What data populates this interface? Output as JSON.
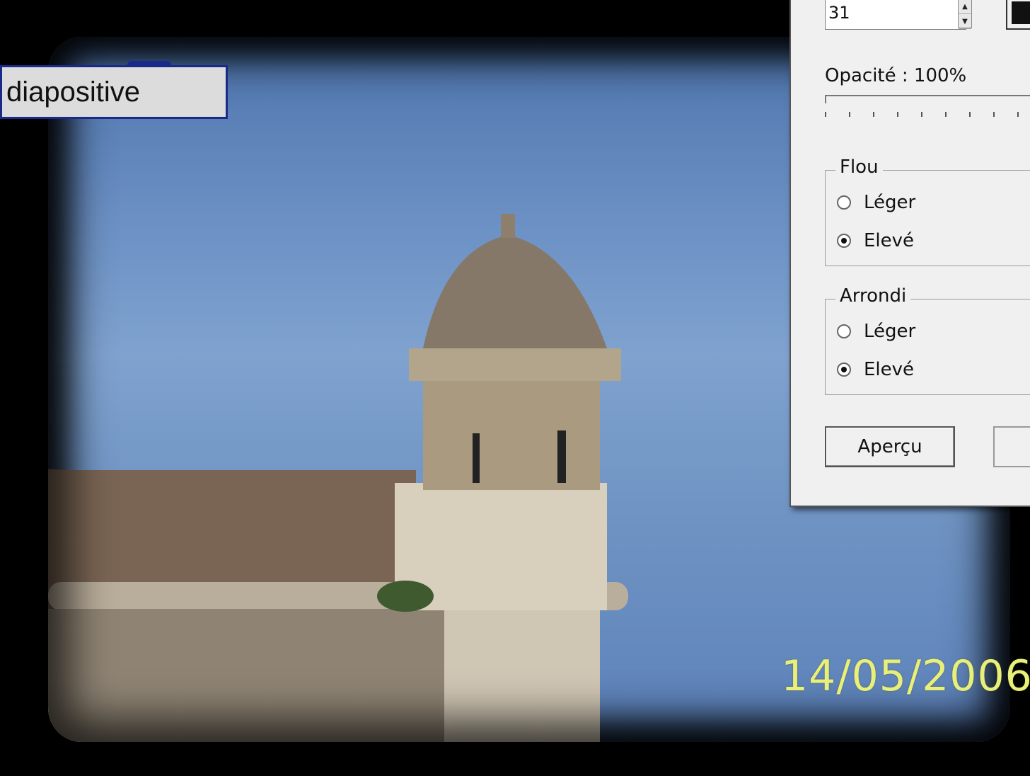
{
  "slide": {
    "label": "diapositive",
    "date_stamp": "14/05/2006"
  },
  "dialog": {
    "size_value": "31",
    "color_swatch": "#111111",
    "opacity_label": "Opacité : 100%",
    "opacity_percent": 100,
    "flou": {
      "title": "Flou",
      "options": [
        "Léger",
        "Elevé"
      ],
      "selected": "Elevé"
    },
    "arrondi": {
      "title": "Arrondi",
      "options": [
        "Léger",
        "Elevé"
      ],
      "selected": "Elevé"
    },
    "preview_label": "Aperçu"
  }
}
